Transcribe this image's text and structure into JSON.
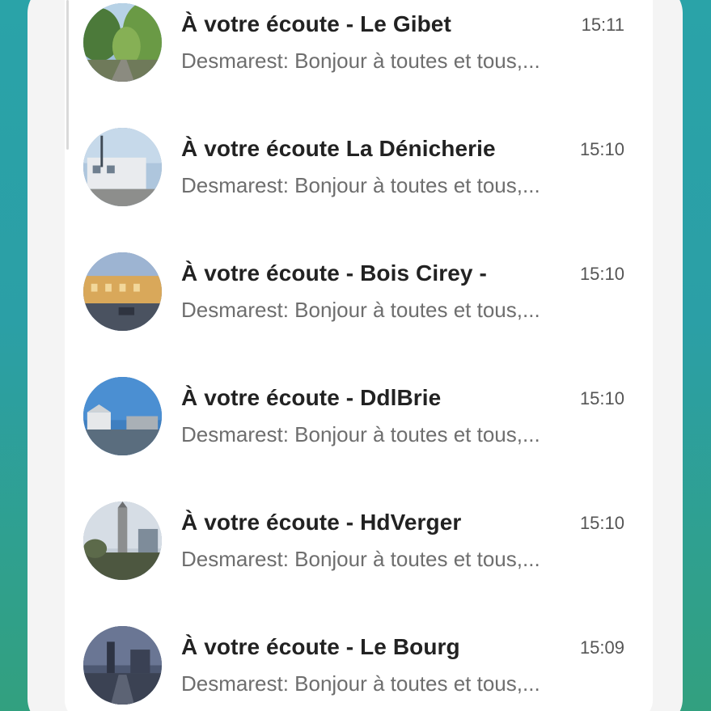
{
  "conversations": [
    {
      "title": "À votre écoute - Le Gibet",
      "time": "15:11",
      "preview": "Desmarest: Bonjour à toutes et tous,...",
      "avatar_icon": "photo-trees-road"
    },
    {
      "title": "À votre écoute La Dénicherie",
      "time": "15:10",
      "preview": "Desmarest: Bonjour à toutes et tous,...",
      "avatar_icon": "photo-white-building"
    },
    {
      "title": "À votre écoute - Bois Cirey -",
      "time": "15:10",
      "preview": "Desmarest: Bonjour à toutes et tous,...",
      "avatar_icon": "photo-street-buildings"
    },
    {
      "title": "À votre écoute - DdlBrie",
      "time": "15:10",
      "preview": "Desmarest: Bonjour à toutes et tous,...",
      "avatar_icon": "photo-blue-sky-town"
    },
    {
      "title": "À votre écoute - HdVerger",
      "time": "15:10",
      "preview": "Desmarest: Bonjour à toutes et tous,...",
      "avatar_icon": "photo-church-tower"
    },
    {
      "title": "À votre écoute - Le Bourg",
      "time": "15:09",
      "preview": "Desmarest: Bonjour à toutes et tous,...",
      "avatar_icon": "photo-dusk-street"
    }
  ],
  "colors": {
    "background_top": "#2aa3a8",
    "background_bottom": "#32a07f",
    "title": "#222222",
    "preview": "#6e6e6e",
    "time": "#555555"
  }
}
